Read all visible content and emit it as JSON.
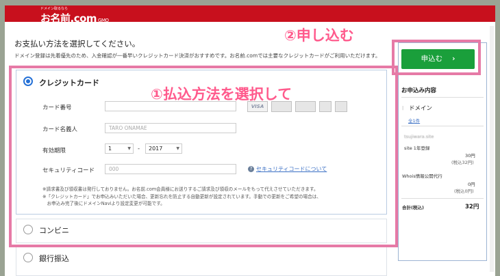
{
  "header": {
    "logo_small": "ドメイン取るなら",
    "logo_main": "お名前.com",
    "logo_sub": "GMO"
  },
  "page": {
    "heading": "お支払い方法を選択してください。",
    "subtext": "ドメイン登録は先着優先のため、入金確認が一番早いクレジットカード決済がおすすめです。お名前.comでは主要なクレジットカードがご利用いただけます。"
  },
  "callouts": {
    "step1": "①払込方法を選択して",
    "step2": "②申し込む"
  },
  "payment": {
    "credit": {
      "label": "クレジットカード",
      "card_number_label": "カード番号",
      "card_name_label": "カード名義人",
      "card_name_placeholder": "TARO ONAMAE",
      "expiry_label": "有効期限",
      "expiry_month": "1",
      "expiry_separator": "-",
      "expiry_year": "2017",
      "security_label": "セキュリティコード",
      "security_placeholder": "000",
      "security_help": "セキュリティコードについて",
      "card_brands": [
        "VISA",
        "MasterCard",
        "JCB",
        "Diners",
        "AMEX"
      ],
      "notes": [
        "※請求書及び領収書は発行しておりません。お名前.com会員様にお送りするご請求及び領収のメールをもって代えさせていただきます。",
        "※「クレジットカード」でお申込みいただいた場合、更新忘れを防止する自動更新が設定されています。手動での更新をご希望の場合は、",
        "　お申込み完了後にドメインNaviより設定変更が可能です。"
      ]
    },
    "convenience": {
      "label": "コンビニ"
    },
    "bank": {
      "label": "銀行振込"
    }
  },
  "sidebar": {
    "apply_label": "申込む",
    "apply_chevron": "›",
    "summary_title": "お申込み内容",
    "domain_label": "ドメイン",
    "domain_count": "全1件",
    "domain_name": "tsujiwara.site",
    "year_label": "site 1年登録",
    "price1": "30円",
    "price1_tax": "(税込32円)",
    "whois_label": "Whois情報公開代行",
    "price2": "0円",
    "price2_tax": "(税込0円)",
    "total_label": "合計(税込)",
    "total_value": "32円"
  },
  "colors": {
    "brand_red": "#c8101d",
    "accent_blue": "#2470d6",
    "callout_pink": "#ff5a8c",
    "apply_green": "#1a9f3b"
  }
}
